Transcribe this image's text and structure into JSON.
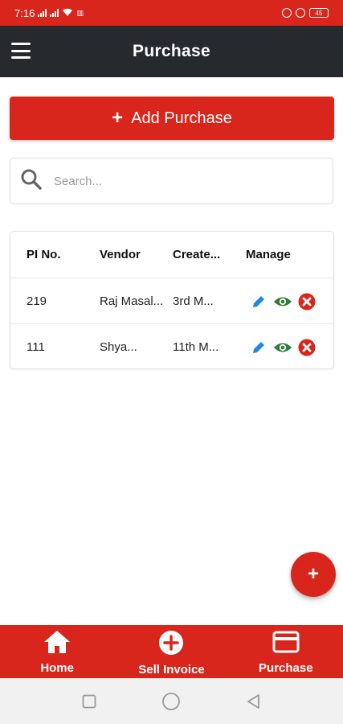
{
  "status_bar": {
    "time": "7:16",
    "battery": "45"
  },
  "app_bar": {
    "title": "Purchase"
  },
  "add_button": {
    "plus": "+",
    "label": "Add Purchase"
  },
  "search": {
    "placeholder": "Search..."
  },
  "table": {
    "headers": [
      "PI No.",
      "Vendor",
      "Create...",
      "Manage"
    ],
    "rows": [
      {
        "pi_no": "219",
        "vendor": "Raj Masal...",
        "created": "3rd M..."
      },
      {
        "pi_no": "111",
        "vendor": "Shya...",
        "created": "11th M..."
      }
    ]
  },
  "fab": {
    "label": "+"
  },
  "bottom_nav": [
    {
      "label": "Home",
      "icon": "home-icon"
    },
    {
      "label": "Sell Invoice",
      "icon": "plus-circle-icon"
    },
    {
      "label": "Purchase",
      "icon": "card-icon"
    }
  ],
  "colors": {
    "primary": "#d8261c",
    "app_bar": "#26292d",
    "edit": "#1e88e5",
    "view": "#2e7d32",
    "delete": "#d8261c"
  }
}
